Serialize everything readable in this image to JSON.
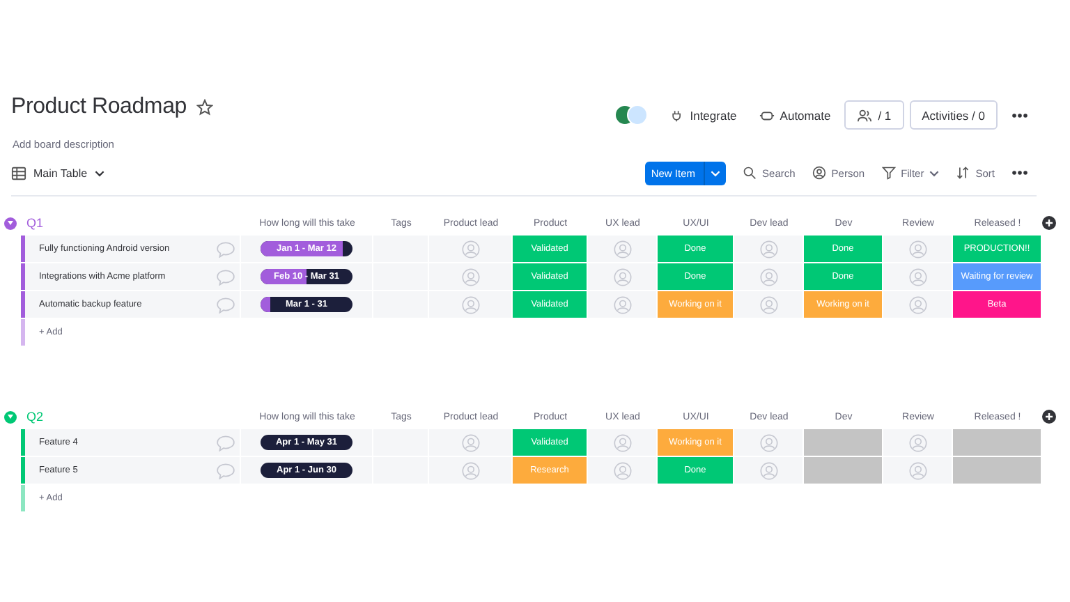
{
  "board": {
    "title": "Product Roadmap",
    "description": "Add board description"
  },
  "top_actions": [
    {
      "kind": "avatars"
    },
    {
      "kind": "integrate",
      "label": "Integrate"
    },
    {
      "kind": "automate",
      "label": "Automate"
    },
    {
      "kind": "members",
      "label": "/ 1"
    },
    {
      "kind": "activities",
      "label": "Activities / 0"
    },
    {
      "kind": "more"
    }
  ],
  "view": {
    "label": "Main Table"
  },
  "toolbar": [
    {
      "kind": "new",
      "label": "New Item"
    },
    {
      "kind": "search",
      "label": "Search"
    },
    {
      "kind": "person",
      "label": "Person"
    },
    {
      "kind": "filter",
      "label": "Filter"
    },
    {
      "kind": "sort",
      "label": "Sort"
    },
    {
      "kind": "more"
    }
  ],
  "groups": [
    {
      "title": "Q1",
      "color": "#a25ddc",
      "columns": [
        "How long will this take",
        "Tags",
        "Product lead",
        "Product",
        "UX lead",
        "UX/UI",
        "Dev lead",
        "Dev",
        "Review",
        "Released !"
      ],
      "add_label": "+ Add",
      "rows": [
        {
          "name": "Fully functioning Android version",
          "timeline": {
            "label": "Jan 1 - Mar 12",
            "level": 0.9
          },
          "product": {
            "label": "Validated",
            "color": "#00c875"
          },
          "ux_ui": {
            "label": "Done",
            "color": "#00c875"
          },
          "dev": {
            "label": "Done",
            "color": "#00c875"
          },
          "released": {
            "label": "PRODUCTION!!",
            "color": "#00c875"
          }
        },
        {
          "name": "Integrations with Acme platform",
          "timeline": {
            "label": "Feb 10 - Mar 31",
            "level": 0.5
          },
          "product": {
            "label": "Validated",
            "color": "#00c875"
          },
          "ux_ui": {
            "label": "Done",
            "color": "#00c875"
          },
          "dev": {
            "label": "Done",
            "color": "#00c875"
          },
          "released": {
            "label": "Waiting for review",
            "color": "#579bfc"
          }
        },
        {
          "name": "Automatic backup feature",
          "timeline": {
            "label": "Mar 1 - 31",
            "level": 0.1
          },
          "product": {
            "label": "Validated",
            "color": "#00c875"
          },
          "ux_ui": {
            "label": "Working on it",
            "color": "#fdab3d"
          },
          "dev": {
            "label": "Working on it",
            "color": "#fdab3d"
          },
          "released": {
            "label": "Beta",
            "color": "#ff158a"
          }
        }
      ]
    },
    {
      "title": "Q2",
      "color": "#00c875",
      "columns": [
        "How long will this take",
        "Tags",
        "Product lead",
        "Product",
        "UX lead",
        "UX/UI",
        "Dev lead",
        "Dev",
        "Review",
        "Released !"
      ],
      "add_label": "+ Add",
      "rows": [
        {
          "name": "Feature 4",
          "timeline": {
            "label": "Apr 1 - May 31",
            "level": 0
          },
          "product": {
            "label": "Validated",
            "color": "#00c875"
          },
          "ux_ui": {
            "label": "Working on it",
            "color": "#fdab3d"
          },
          "dev": {
            "color": "#c4c4c4"
          },
          "released": {
            "color": "#c4c4c4"
          }
        },
        {
          "name": "Feature 5",
          "timeline": {
            "label": "Apr 1 - Jun 30",
            "level": 0
          },
          "product": {
            "label": "Research",
            "color": "#fdab3d"
          },
          "ux_ui": {
            "label": "Done",
            "color": "#00c875"
          },
          "dev": {
            "color": "#c4c4c4"
          },
          "released": {
            "color": "#c4c4c4"
          }
        }
      ]
    }
  ]
}
